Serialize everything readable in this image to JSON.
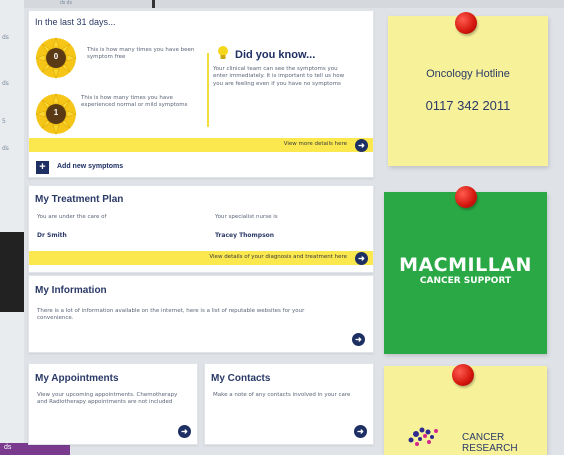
{
  "background": {
    "left_labels": [
      "ds",
      "ds",
      "5",
      "ds"
    ],
    "top_label": "ds ds",
    "taskbar_label": "ds"
  },
  "summary": {
    "title": "In the last 31 days...",
    "stats": [
      {
        "count": "0",
        "text": "This is how many times you have been symptom free"
      },
      {
        "count": "1",
        "text": "This is how many times you have experienced normal or mild symptoms"
      }
    ],
    "did_you_know": {
      "heading": "Did you know...",
      "text": "Your clinical team can see the symptoms you enter immediately. It is important to tell us how you are feeling even if you have no symptoms"
    },
    "more_link": "View more details here",
    "add_label": "Add new symptoms"
  },
  "treatment": {
    "title": "My Treatment Plan",
    "care_label": "You are under the care of",
    "care_value": "Dr Smith",
    "nurse_label": "Your specialist nurse is",
    "nurse_value": "Tracey Thompson",
    "details_link": "View details of your diagnosis and treatment here"
  },
  "information": {
    "title": "My Information",
    "text": "There is a lot of information available on the internet, here is a list of reputable websites for your convenience."
  },
  "appointments": {
    "title": "My Appointments",
    "text": "View your upcoming appointments. Chemotherapy and Radiotherapy appointments are not included"
  },
  "contacts": {
    "title": "My Contacts",
    "text": "Make a note of any contacts involved in your care"
  },
  "notes": {
    "hotline_title": "Oncology Hotline",
    "hotline_number": "0117 342 2011",
    "macmillan_line1": "MACMILLAN",
    "macmillan_line2": "CANCER SUPPORT",
    "cancer_line1": "CANCER",
    "cancer_line2": "RESEARCH"
  },
  "colors": {
    "navy": "#1d2f63",
    "yellow": "#fbe84f",
    "note_yellow": "#f7f29a",
    "macmillan_green": "#2aa845",
    "pin_red": "#d3160d"
  }
}
